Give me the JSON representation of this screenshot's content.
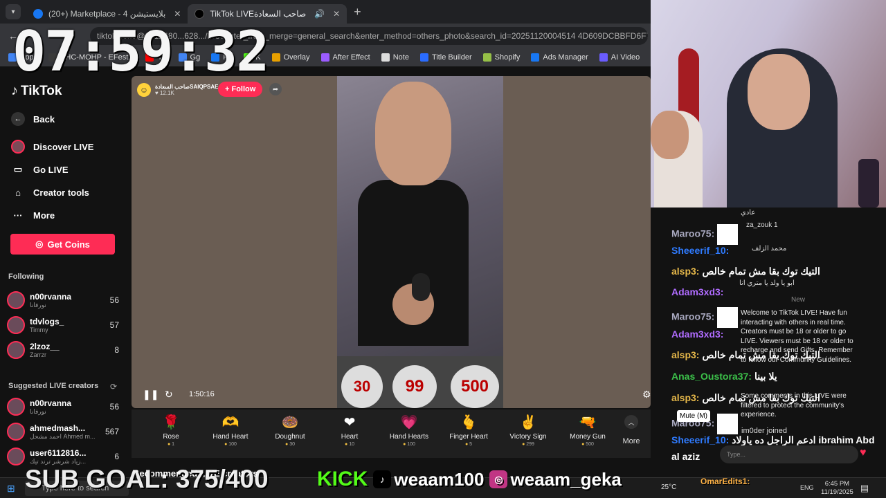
{
  "browser": {
    "tabs": [
      {
        "label": "(20+) Marketplace - 4 بلايستيشن",
        "icon": "facebook-icon",
        "active": false
      },
      {
        "label": "TikTok LIVEصاحب السعادة",
        "icon": "tiktok-icon",
        "active": true
      }
    ],
    "url": "tiktok.com/@0912480...628.../live?enter_from_merge=general_search&enter_method=others_photo&search_id=20251120004514 4D609DCBBFD6F777F56",
    "bookmarks": [
      "Apps",
      "EHC-MOHP - EFest...",
      "YT",
      "Gg",
      "FB",
      "K",
      "Overlay",
      "After Effect",
      "Note",
      "Title Builder",
      "Shopify",
      "Ads Manager",
      "AI Video"
    ]
  },
  "sidebar": {
    "brand": "TikTok",
    "back": "Back",
    "nav": [
      {
        "label": "Discover LIVE",
        "icon": "discover-icon"
      },
      {
        "label": "Go LIVE",
        "icon": "camera-icon"
      },
      {
        "label": "Creator tools",
        "icon": "lightbulb-icon"
      },
      {
        "label": "More",
        "icon": "more-icon"
      }
    ],
    "coins_button": "Get Coins",
    "following_title": "Following",
    "following": [
      {
        "name": "n00rvanna",
        "sub": "نورفانا",
        "count": "56"
      },
      {
        "name": "tdvlogs_",
        "sub": "Timmy",
        "count": "57"
      },
      {
        "name": "2lzoz__",
        "sub": "Zarrzr",
        "count": "8"
      }
    ],
    "suggested_title": "Suggested LIVE creators",
    "suggested": [
      {
        "name": "n00rvanna",
        "sub": "نورفانا",
        "count": "56"
      },
      {
        "name": "ahmedmash...",
        "sub": "احمد مشحل Ahmed m...",
        "count": "567"
      },
      {
        "name": "user6112816...",
        "sub": "زياد شرشر ترند تيك...",
        "count": "6"
      }
    ]
  },
  "live": {
    "host_name": "صاحب السعادةSAIQPSAE",
    "host_viewers": "12.1K",
    "follow_label": "+ Follow",
    "elapsed": "1:50:16",
    "balloons": [
      "30",
      "99",
      "500"
    ],
    "recommended": "Recommended LIVE creators"
  },
  "gifts": [
    {
      "name": "Rose",
      "price": "1",
      "icon": "🌹"
    },
    {
      "name": "Hand Heart",
      "price": "100",
      "icon": "🫶"
    },
    {
      "name": "Doughnut",
      "price": "30",
      "icon": "🍩"
    },
    {
      "name": "Heart",
      "price": "10",
      "icon": "❤"
    },
    {
      "name": "Hand Hearts",
      "price": "100",
      "icon": "💗"
    },
    {
      "name": "Finger Heart",
      "price": "5",
      "icon": "🫰"
    },
    {
      "name": "Victory Sign",
      "price": "299",
      "icon": "✌"
    },
    {
      "name": "Money Gun",
      "price": "500",
      "icon": "🔫"
    }
  ],
  "gifts_more": "More",
  "overlay": {
    "clock": "07:59:32",
    "subgoal": "SUB GOAL: 375/400",
    "kick": "KICK",
    "tiktok_handle": "weaam100",
    "instagram_handle": "weaam_geka"
  },
  "stream_chat": [
    {
      "user": "Maroo75:",
      "color": "#a9a9c0",
      "msg": "",
      "img": true
    },
    {
      "user": "Sheeerif_10:",
      "color": "#2f7bff",
      "msg": "",
      "img": false
    },
    {
      "user": "alsp3:",
      "color": "#e6b84a",
      "msg": "التيك توك بقا مش تمام خالص",
      "img": false
    },
    {
      "user": "Adam3xd3:",
      "color": "#b06cff",
      "msg": "",
      "img": false
    },
    {
      "user": "Maroo75:",
      "color": "#a9a9c0",
      "msg": "",
      "img": true
    },
    {
      "user": "Adam3xd3:",
      "color": "#b06cff",
      "msg": "",
      "img": false
    },
    {
      "user": "alsp3:",
      "color": "#e6b84a",
      "msg": "التيك توك بقا مش تمام خالص",
      "img": false
    },
    {
      "user": "Anas_Oustora37:",
      "color": "#3cc24a",
      "msg": "يلا بينا",
      "img": false
    },
    {
      "user": "alsp3:",
      "color": "#e6b84a",
      "msg": "التيك توك بقا مش تمام خالص",
      "img": false
    },
    {
      "user": "Maroo75:",
      "color": "#a9a9c0",
      "msg": "",
      "img": true
    },
    {
      "user": "Sheeerif_10:",
      "color": "#2f7bff",
      "msg": "ادعم الراجل ده ياولاد ibrahim Abd",
      "img": false
    },
    {
      "user": "al aziz",
      "color": "#ffffff",
      "msg": "",
      "img": false
    }
  ],
  "tiktok_chat": {
    "lines": [
      "za_zouk 1",
      "محمد الزلف",
      "ابو يا ولد يا متري انا",
      "New"
    ],
    "welcome": "Welcome to TikTok LIVE! Have fun interacting with others in real time. Creators must be 18 or older to go LIVE. Viewers must be 18 or older to recharge and send Gifts. Remember to follow our Community Guidelines.",
    "joined_notice": "Some comments in this LIVE were filtered to protect the community's experience.",
    "joined": "im0der joined",
    "mute_tip": "Mute (M)",
    "input_placeholder": "Type...",
    "top_text": "عادي"
  },
  "taskbar": {
    "search": "Type here to search",
    "weather": "25°C",
    "lang": "ENG",
    "time": "6:45 PM",
    "date": "11/19/2025",
    "stream_tag": "OmarEdits1:"
  }
}
